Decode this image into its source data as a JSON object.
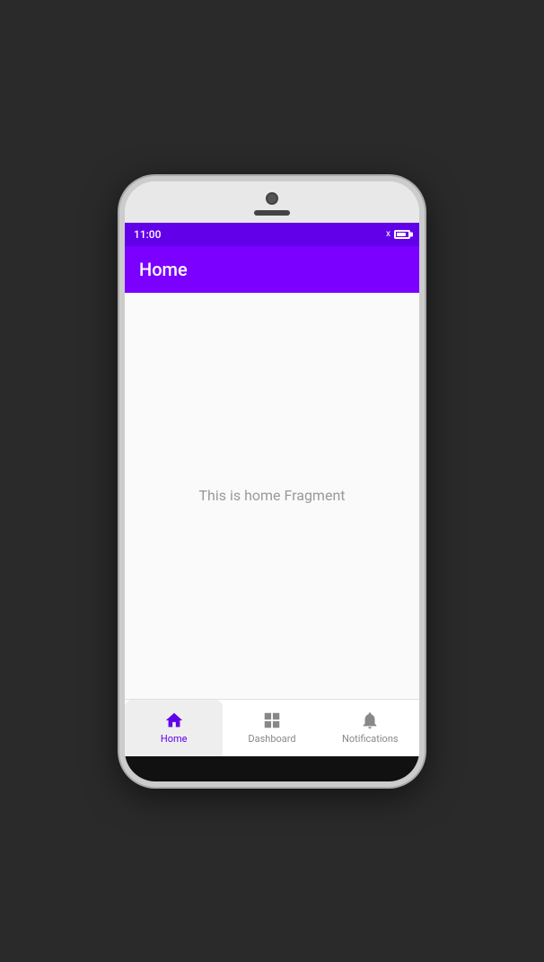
{
  "phone": {
    "status_bar": {
      "time": "11:00",
      "battery_x": "x",
      "icons_label": "status icons"
    },
    "app_bar": {
      "title": "Home"
    },
    "content": {
      "text": "This is home Fragment"
    },
    "bottom_nav": {
      "items": [
        {
          "id": "home",
          "label": "Home",
          "active": true,
          "icon": "home-icon"
        },
        {
          "id": "dashboard",
          "label": "Dashboard",
          "active": false,
          "icon": "dashboard-icon"
        },
        {
          "id": "notifications",
          "label": "Notifications",
          "active": false,
          "icon": "bell-icon"
        }
      ]
    }
  }
}
